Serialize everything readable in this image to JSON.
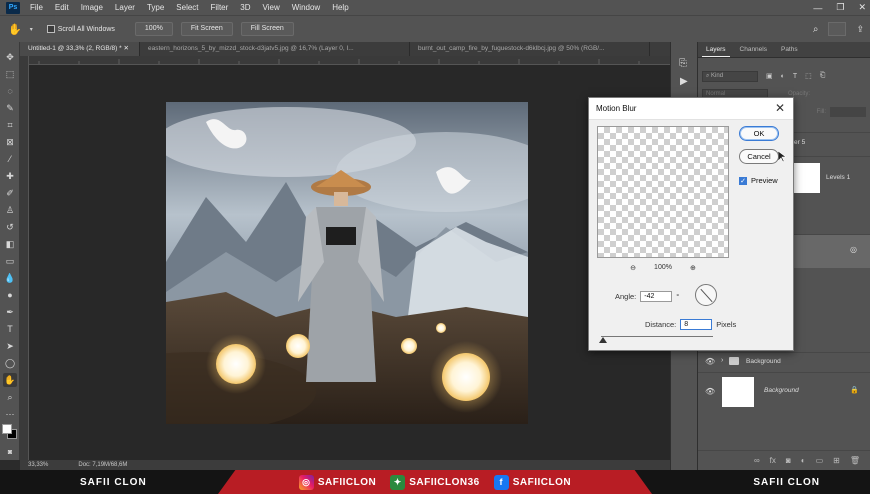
{
  "menubar": {
    "logo": "Ps",
    "items": [
      "File",
      "Edit",
      "Image",
      "Layer",
      "Type",
      "Select",
      "Filter",
      "3D",
      "View",
      "Window",
      "Help"
    ]
  },
  "options": {
    "scroll_all_windows": "Scroll All Windows",
    "zoom_100": "100%",
    "fit_screen": "Fit Screen",
    "fill_screen": "Fill Screen"
  },
  "tabs": [
    "Untitled-1 @ 33,3% (2, RGB/8) *",
    "eastern_horizons_5_by_mizzd_stock-d3jatv5.jpg @ 16,7% (Layer 0, I...",
    "burnt_out_camp_fire_by_fuguestock-d6klbcj.jpg @ 50% (RGB/..."
  ],
  "status": {
    "zoom": "33,33%",
    "doc": "Doc: 7,19M/68,6M"
  },
  "layers_panel": {
    "tabs": [
      "Layers",
      "Channels",
      "Paths"
    ],
    "kind": "Kind",
    "blend": "Normal",
    "opacity_label": "Opacity:",
    "fill_label": "Fill:",
    "partial_name": "er 5",
    "levels_name": "Levels 1",
    "group_name": "Background",
    "bg_name": "Background"
  },
  "dialog": {
    "title": "Motion Blur",
    "ok": "OK",
    "cancel": "Cancel",
    "preview": "Preview",
    "zoom_level": "100%",
    "angle_label": "Angle:",
    "angle_value": "-42",
    "angle_unit": "°",
    "distance_label": "Distance:",
    "distance_value": "8",
    "distance_unit": "Pixels"
  },
  "banner": {
    "left": "SAFII CLON",
    "instagram": "SAFIICLON",
    "gfycat": "SAFIICLON36",
    "facebook": "SAFIICLON",
    "right": "SAFII CLON"
  }
}
